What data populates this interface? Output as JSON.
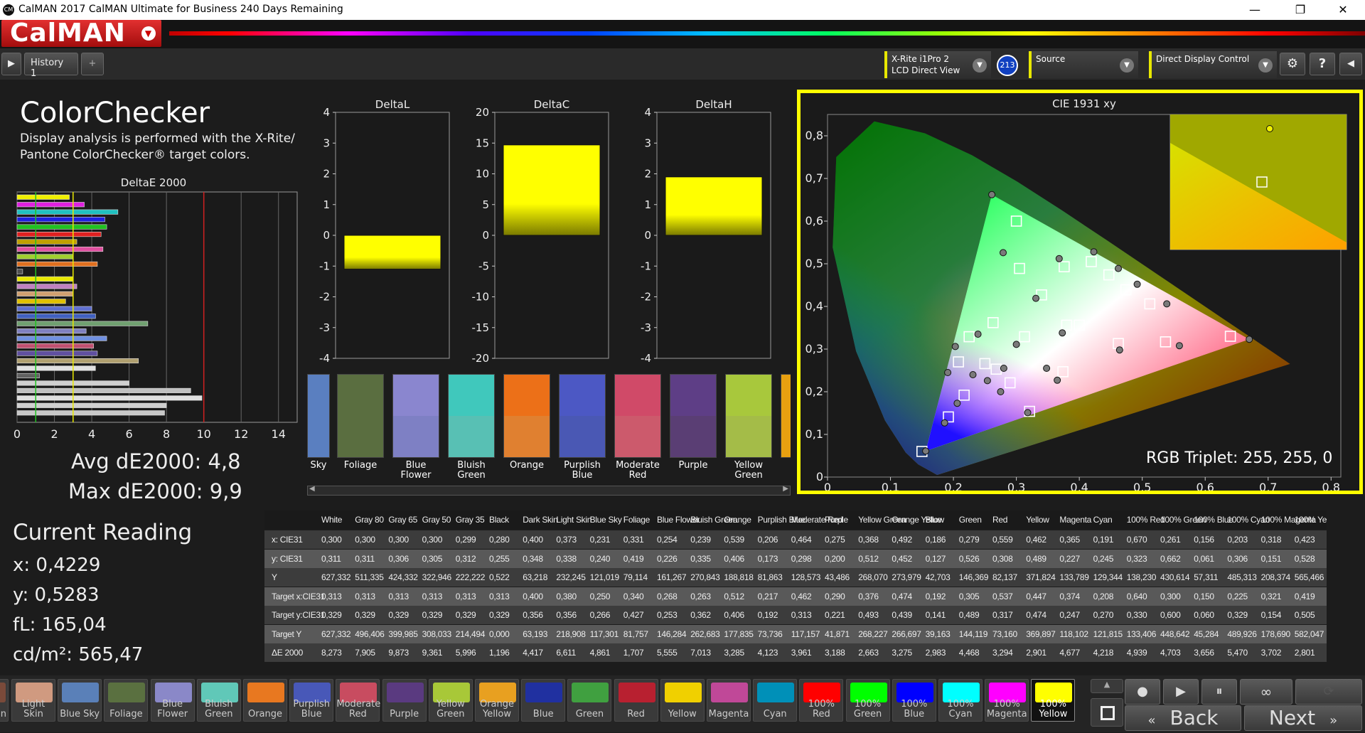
{
  "window": {
    "title": "CalMAN 2017 CalMAN Ultimate for Business 240 Days Remaining",
    "logo": "CM",
    "minimize": "—",
    "maximize": "❐",
    "close": "✕"
  },
  "brand": {
    "name": "CalMAN"
  },
  "tabs": {
    "history": "History 1",
    "add": "+"
  },
  "devices": {
    "meter_line1": "X-Rite i1Pro 2",
    "meter_line2": "LCD Direct View",
    "meter_badge": "213",
    "source": "Source",
    "ddc": "Direct Display Control"
  },
  "colorchecker": {
    "title": "ColorChecker",
    "desc_line1": "Display analysis is performed with the X-Rite/",
    "desc_line2": "Pantone ColorChecker® target colors."
  },
  "stats": {
    "avg": "Avg dE2000: 4,8",
    "max": "Max dE2000: 9,9"
  },
  "current_reading": {
    "title": "Current Reading",
    "x": "x: 0,4229",
    "y": "y: 0,5283",
    "fl": "fL: 165,04",
    "cdm2": "cd/m²: 565,47"
  },
  "rgb_triplet": "RGB Triplet: 255, 255, 0",
  "chart_data": [
    {
      "type": "bar",
      "title": "DeltaE 2000",
      "orientation": "horizontal",
      "xlim": [
        0,
        15
      ],
      "xticks": [
        "0",
        "2",
        "4",
        "6",
        "8",
        "10",
        "12",
        "14"
      ],
      "threshold_lines": [
        {
          "value": 3,
          "color": "#e8e800"
        },
        {
          "value": 10,
          "color": "#d02020"
        },
        {
          "value": 1,
          "color": "#20c020"
        }
      ],
      "values": [
        2.8,
        3.6,
        5.4,
        4.7,
        4.8,
        4.5,
        3.2,
        4.6,
        3.0,
        4.3,
        0.3,
        3.0,
        3.2,
        3.0,
        2.6,
        4.0,
        4.2,
        7.0,
        3.7,
        4.8,
        4.1,
        4.3,
        6.5,
        4.2,
        1.2,
        6.0,
        9.3,
        9.9,
        8.0,
        7.9
      ],
      "colors": [
        "#f0f000",
        "#e020e0",
        "#20c0c0",
        "#2020e0",
        "#20c020",
        "#e02020",
        "#c0a000",
        "#e050a0",
        "#a0d030",
        "#e07020",
        "#505050",
        "#e8e800",
        "#c080c0",
        "#d0a070",
        "#e0c000",
        "#6070d0",
        "#4060c0",
        "#70a070",
        "#8080c0",
        "#7090e0",
        "#c05070",
        "#6050a0",
        "#b0a070",
        "#e0e0e0",
        "#606060",
        "#d0d0d0",
        "#c0c0c0",
        "#e0e0e0",
        "#d0d0d0",
        "#c8c8c8"
      ]
    },
    {
      "type": "bar",
      "title": "DeltaL",
      "ylim": [
        -4,
        4
      ],
      "yticks": [
        "4",
        "3",
        "2",
        "1",
        "0",
        "-1",
        "-2",
        "-3",
        "-4"
      ],
      "values": [
        -1.1
      ]
    },
    {
      "type": "bar",
      "title": "DeltaC",
      "ylim": [
        -20,
        20
      ],
      "yticks": [
        "20",
        "15",
        "10",
        "5",
        "0",
        "-5",
        "-10",
        "-15",
        "-20"
      ],
      "values": [
        14.7
      ]
    },
    {
      "type": "bar",
      "title": "DeltaH",
      "ylim": [
        -4,
        4
      ],
      "yticks": [
        "4",
        "3",
        "2",
        "1",
        "0",
        "-1",
        "-2",
        "-3",
        "-4"
      ],
      "values": [
        1.9
      ]
    },
    {
      "type": "scatter",
      "title": "CIE 1931 xy",
      "xlim": [
        0,
        0.8
      ],
      "ylim": [
        0,
        0.85
      ],
      "xticks": [
        "0",
        "0,1",
        "0,2",
        "0,3",
        "0,4",
        "0,5",
        "0,6",
        "0,7",
        "0,8"
      ],
      "yticks": [
        "0",
        "0,1",
        "0,2",
        "0,3",
        "0,4",
        "0,5",
        "0,6",
        "0,7",
        "0,8"
      ],
      "gamut_target": [
        [
          0.64,
          0.33
        ],
        [
          0.3,
          0.6
        ],
        [
          0.15,
          0.06
        ]
      ],
      "targets": [
        [
          0.313,
          0.329
        ],
        [
          0.4,
          0.356
        ],
        [
          0.38,
          0.356
        ],
        [
          0.25,
          0.266
        ],
        [
          0.34,
          0.427
        ],
        [
          0.268,
          0.253
        ],
        [
          0.263,
          0.362
        ],
        [
          0.512,
          0.406
        ],
        [
          0.217,
          0.192
        ],
        [
          0.462,
          0.313
        ],
        [
          0.29,
          0.221
        ],
        [
          0.376,
          0.493
        ],
        [
          0.474,
          0.439
        ],
        [
          0.192,
          0.141
        ],
        [
          0.305,
          0.489
        ],
        [
          0.537,
          0.317
        ],
        [
          0.447,
          0.474
        ],
        [
          0.374,
          0.247
        ],
        [
          0.208,
          0.27
        ],
        [
          0.64,
          0.33
        ],
        [
          0.3,
          0.6
        ],
        [
          0.15,
          0.06
        ],
        [
          0.225,
          0.329
        ],
        [
          0.321,
          0.154
        ],
        [
          0.419,
          0.505
        ]
      ],
      "measured": [
        [
          0.3,
          0.311
        ],
        [
          0.373,
          0.338
        ],
        [
          0.348,
          0.255
        ],
        [
          0.231,
          0.24
        ],
        [
          0.331,
          0.419
        ],
        [
          0.254,
          0.226
        ],
        [
          0.239,
          0.335
        ],
        [
          0.539,
          0.406
        ],
        [
          0.206,
          0.173
        ],
        [
          0.464,
          0.298
        ],
        [
          0.275,
          0.2
        ],
        [
          0.368,
          0.512
        ],
        [
          0.492,
          0.452
        ],
        [
          0.186,
          0.127
        ],
        [
          0.279,
          0.526
        ],
        [
          0.559,
          0.308
        ],
        [
          0.462,
          0.489
        ],
        [
          0.365,
          0.227
        ],
        [
          0.191,
          0.245
        ],
        [
          0.67,
          0.323
        ],
        [
          0.261,
          0.662
        ],
        [
          0.156,
          0.061
        ],
        [
          0.203,
          0.306
        ],
        [
          0.318,
          0.151
        ],
        [
          0.423,
          0.528
        ],
        [
          0.28,
          0.255
        ]
      ],
      "current": [
        0.4229,
        0.5283
      ]
    }
  ],
  "swatch_strip": [
    {
      "name": "Sky",
      "top": "#5a7fc0",
      "bottom": "#5a7fc0"
    },
    {
      "name": "Foliage",
      "top": "#5a6e40",
      "bottom": "#5a6e40"
    },
    {
      "name": "Blue Flower",
      "top": "#8a86cf",
      "bottom": "#7e80c4"
    },
    {
      "name": "Bluish Green",
      "top": "#40c8bc",
      "bottom": "#58c0b4"
    },
    {
      "name": "Orange",
      "top": "#ec7018",
      "bottom": "#e08030"
    },
    {
      "name": "Purplish Blue",
      "top": "#4c58c4",
      "bottom": "#4a58b4"
    },
    {
      "name": "Moderate Red",
      "top": "#d04a68",
      "bottom": "#cc5a6c"
    },
    {
      "name": "Purple",
      "top": "#5e3e86",
      "bottom": "#5a3e74"
    },
    {
      "name": "Yellow Green",
      "top": "#a8c83c",
      "bottom": "#a4bc48"
    },
    {
      "name": "",
      "top": "#e8a010",
      "bottom": "#e8a010"
    }
  ],
  "table": {
    "columns": [
      "White",
      "Gray 80",
      "Gray 65",
      "Gray 50",
      "Gray 35",
      "Black",
      "Dark Skin",
      "Light Skin",
      "Blue Sky",
      "Foliage",
      "Blue Flower",
      "Bluish Green",
      "Orange",
      "Purplish Blue",
      "Moderate Red",
      "Purple",
      "Yellow Green",
      "Orange Yellow",
      "Blue",
      "Green",
      "Red",
      "Yellow",
      "Magenta",
      "Cyan",
      "100% Red",
      "100% Green",
      "100% Blue",
      "100% Cyan",
      "100% Magenta",
      "100% Yellow"
    ],
    "rows": [
      {
        "label": "x: CIE31",
        "values": [
          "0,300",
          "0,300",
          "0,300",
          "0,300",
          "0,299",
          "0,280",
          "0,400",
          "0,373",
          "0,231",
          "0,331",
          "0,254",
          "0,239",
          "0,539",
          "0,206",
          "0,464",
          "0,275",
          "0,368",
          "0,492",
          "0,186",
          "0,279",
          "0,559",
          "0,462",
          "0,365",
          "0,191",
          "0,670",
          "0,261",
          "0,156",
          "0,203",
          "0,318",
          "0,423"
        ]
      },
      {
        "label": "y: CIE31",
        "values": [
          "0,311",
          "0,311",
          "0,306",
          "0,305",
          "0,312",
          "0,255",
          "0,348",
          "0,338",
          "0,240",
          "0,419",
          "0,226",
          "0,335",
          "0,406",
          "0,173",
          "0,298",
          "0,200",
          "0,512",
          "0,452",
          "0,127",
          "0,526",
          "0,308",
          "0,489",
          "0,227",
          "0,245",
          "0,323",
          "0,662",
          "0,061",
          "0,306",
          "0,151",
          "0,528"
        ]
      },
      {
        "label": "Y",
        "values": [
          "627,332",
          "511,335",
          "424,332",
          "322,946",
          "222,222",
          "0,522",
          "63,218",
          "232,245",
          "121,019",
          "79,114",
          "161,267",
          "270,843",
          "188,818",
          "81,863",
          "128,573",
          "43,486",
          "268,070",
          "273,979",
          "42,703",
          "146,369",
          "82,137",
          "371,824",
          "133,789",
          "129,344",
          "138,230",
          "430,614",
          "57,311",
          "485,313",
          "208,374",
          "565,466"
        ]
      },
      {
        "label": "Target x:CIE31",
        "values": [
          "0,313",
          "0,313",
          "0,313",
          "0,313",
          "0,313",
          "0,313",
          "0,400",
          "0,380",
          "0,250",
          "0,340",
          "0,268",
          "0,263",
          "0,512",
          "0,217",
          "0,462",
          "0,290",
          "0,376",
          "0,474",
          "0,192",
          "0,305",
          "0,537",
          "0,447",
          "0,374",
          "0,208",
          "0,640",
          "0,300",
          "0,150",
          "0,225",
          "0,321",
          "0,419"
        ]
      },
      {
        "label": "Target y:CIE31",
        "values": [
          "0,329",
          "0,329",
          "0,329",
          "0,329",
          "0,329",
          "0,329",
          "0,356",
          "0,356",
          "0,266",
          "0,427",
          "0,253",
          "0,362",
          "0,406",
          "0,192",
          "0,313",
          "0,221",
          "0,493",
          "0,439",
          "0,141",
          "0,489",
          "0,317",
          "0,474",
          "0,247",
          "0,270",
          "0,330",
          "0,600",
          "0,060",
          "0,329",
          "0,154",
          "0,505"
        ]
      },
      {
        "label": "Target Y",
        "values": [
          "627,332",
          "496,406",
          "399,985",
          "308,033",
          "214,494",
          "0,000",
          "63,193",
          "218,908",
          "117,301",
          "81,757",
          "146,284",
          "262,683",
          "177,835",
          "73,736",
          "117,157",
          "41,871",
          "268,227",
          "266,697",
          "39,163",
          "144,119",
          "73,160",
          "369,897",
          "118,102",
          "121,815",
          "133,406",
          "448,642",
          "45,284",
          "489,926",
          "178,690",
          "582,047"
        ]
      },
      {
        "label": "ΔE 2000",
        "values": [
          "8,273",
          "7,905",
          "9,873",
          "9,361",
          "5,996",
          "1,196",
          "4,417",
          "6,611",
          "4,861",
          "1,707",
          "5,555",
          "7,013",
          "3,285",
          "4,123",
          "3,961",
          "3,188",
          "2,663",
          "3,275",
          "2,983",
          "4,468",
          "3,294",
          "2,901",
          "4,677",
          "4,218",
          "4,939",
          "4,703",
          "3,656",
          "5,470",
          "3,702",
          "2,801"
        ]
      }
    ]
  },
  "bottom_swatches": [
    {
      "name": "in",
      "color": "#7a4a3a"
    },
    {
      "name": "Light Skin",
      "color": "#d09a80"
    },
    {
      "name": "Blue Sky",
      "color": "#5a80b8"
    },
    {
      "name": "Foliage",
      "color": "#5a7040"
    },
    {
      "name": "Blue Flower",
      "color": "#8a88c8"
    },
    {
      "name": "Bluish Green",
      "color": "#60c8b8"
    },
    {
      "name": "Orange",
      "color": "#e87820"
    },
    {
      "name": "Purplish Blue",
      "color": "#4858b8"
    },
    {
      "name": "Moderate Red",
      "color": "#c84c60"
    },
    {
      "name": "Purple",
      "color": "#5a3a80"
    },
    {
      "name": "Yellow Green",
      "color": "#a8c838"
    },
    {
      "name": "Orange Yellow",
      "color": "#e8a020"
    },
    {
      "name": "Blue",
      "color": "#2030a0"
    },
    {
      "name": "Green",
      "color": "#40a040"
    },
    {
      "name": "Red",
      "color": "#b82030"
    },
    {
      "name": "Yellow",
      "color": "#f0d000"
    },
    {
      "name": "Magenta",
      "color": "#c04898"
    },
    {
      "name": "Cyan",
      "color": "#0090b8"
    },
    {
      "name": "100% Red",
      "color": "#ff0000"
    },
    {
      "name": "100% Green",
      "color": "#00ff00"
    },
    {
      "name": "100% Blue",
      "color": "#0000ff"
    },
    {
      "name": "100% Cyan",
      "color": "#00ffff"
    },
    {
      "name": "100% Magenta",
      "color": "#ff00ff"
    },
    {
      "name": "100% Yellow",
      "color": "#ffff00"
    }
  ],
  "nav": {
    "back": "Back",
    "next": "Next"
  }
}
